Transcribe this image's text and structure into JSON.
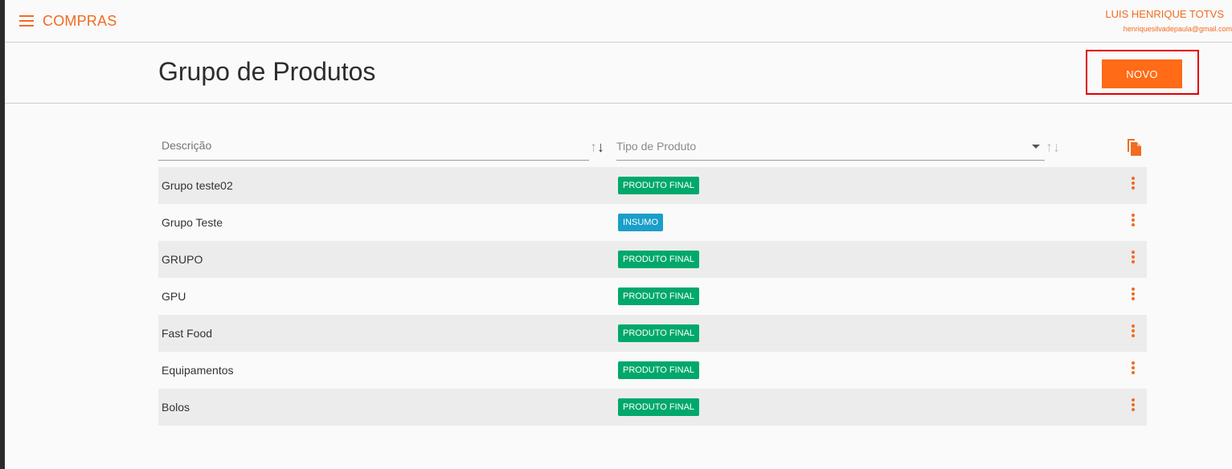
{
  "app": {
    "title": "COMPRAS"
  },
  "user": {
    "name": "LUIS HENRIQUE TOTVS",
    "email": "henriquesilvadepaula@gmail.com"
  },
  "page": {
    "title": "Grupo de Produtos",
    "new_button_label": "NOVO"
  },
  "filters": {
    "description_placeholder": "Descrição",
    "product_type_placeholder": "Tipo de Produto"
  },
  "colors": {
    "accent": "#ff6b17",
    "badge_final": "#00a86b",
    "badge_insumo": "#1a9fc9"
  },
  "rows": [
    {
      "name": "Grupo teste02",
      "type": "PRODUTO FINAL"
    },
    {
      "name": "Grupo Teste",
      "type": "INSUMO"
    },
    {
      "name": "GRUPO",
      "type": "PRODUTO FINAL"
    },
    {
      "name": "GPU",
      "type": "PRODUTO FINAL"
    },
    {
      "name": "Fast Food",
      "type": "PRODUTO FINAL"
    },
    {
      "name": "Equipamentos",
      "type": "PRODUTO FINAL"
    },
    {
      "name": "Bolos",
      "type": "PRODUTO FINAL"
    }
  ]
}
